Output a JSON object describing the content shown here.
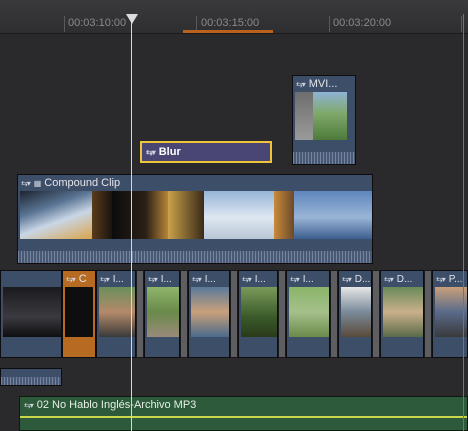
{
  "ruler": {
    "marks": [
      "00:03:10:00",
      "00:03:15:00",
      "00:03:20:00"
    ]
  },
  "clips": {
    "mvi": {
      "label": "MVI..."
    },
    "blur": {
      "label": "Blur"
    },
    "compound": {
      "label": "Compound Clip"
    },
    "primary": [
      {
        "label": "C"
      },
      {
        "label": "I..."
      },
      {
        "label": "I..."
      },
      {
        "label": "I..."
      },
      {
        "label": "I..."
      },
      {
        "label": "I..."
      },
      {
        "label": "D..."
      },
      {
        "label": "D..."
      },
      {
        "label": "I..."
      },
      {
        "label": "P..."
      }
    ]
  },
  "audio": {
    "label": "02 No Hablo Inglés-Archivo MP3"
  },
  "colors": {
    "primary_clip": "#3d4e68",
    "selected_border": "#f0c43a",
    "audio_clip": "#2d5a3a",
    "skimmer": "#d94a3c"
  }
}
